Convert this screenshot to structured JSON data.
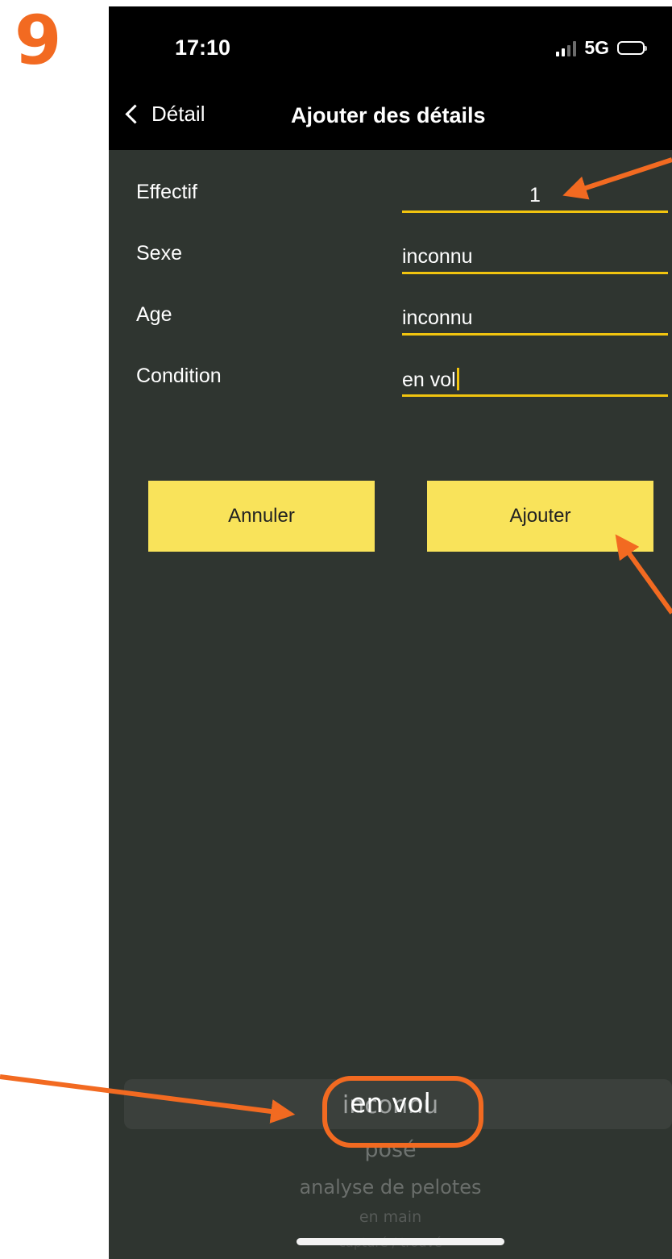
{
  "step_number": "9",
  "status_bar": {
    "time": "17:10",
    "network": "5G",
    "icons": [
      "signal-icon",
      "battery-icon"
    ]
  },
  "nav": {
    "back_label": "Détail",
    "title": "Ajouter des détails"
  },
  "form": {
    "fields": [
      {
        "label": "Effectif",
        "value": "1"
      },
      {
        "label": "Sexe",
        "value": "inconnu"
      },
      {
        "label": "Age",
        "value": "inconnu"
      },
      {
        "label": "Condition",
        "value": "en vol"
      }
    ]
  },
  "buttons": {
    "cancel_label": "Annuler",
    "add_label": "Ajouter"
  },
  "picker": {
    "selected": "en vol",
    "items": [
      "inconnu",
      "en vol",
      "posé",
      "analyse de pelotes",
      "en main",
      "capturé / trouvé"
    ]
  },
  "colors": {
    "screen_background": "#2f3530",
    "nav_background": "#000000",
    "field_underline": "#f1c40f",
    "button_fill": "#f9e35a",
    "annotation": "#f26a21"
  }
}
